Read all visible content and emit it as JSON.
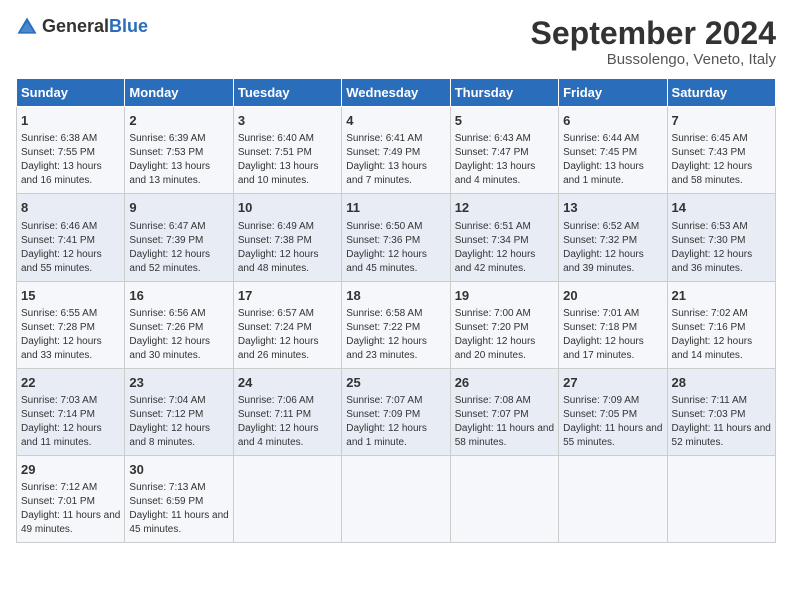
{
  "header": {
    "logo_general": "General",
    "logo_blue": "Blue",
    "month_year": "September 2024",
    "location": "Bussolengo, Veneto, Italy"
  },
  "days_of_week": [
    "Sunday",
    "Monday",
    "Tuesday",
    "Wednesday",
    "Thursday",
    "Friday",
    "Saturday"
  ],
  "weeks": [
    [
      {
        "day": "1",
        "sunrise": "Sunrise: 6:38 AM",
        "sunset": "Sunset: 7:55 PM",
        "daylight": "Daylight: 13 hours and 16 minutes."
      },
      {
        "day": "2",
        "sunrise": "Sunrise: 6:39 AM",
        "sunset": "Sunset: 7:53 PM",
        "daylight": "Daylight: 13 hours and 13 minutes."
      },
      {
        "day": "3",
        "sunrise": "Sunrise: 6:40 AM",
        "sunset": "Sunset: 7:51 PM",
        "daylight": "Daylight: 13 hours and 10 minutes."
      },
      {
        "day": "4",
        "sunrise": "Sunrise: 6:41 AM",
        "sunset": "Sunset: 7:49 PM",
        "daylight": "Daylight: 13 hours and 7 minutes."
      },
      {
        "day": "5",
        "sunrise": "Sunrise: 6:43 AM",
        "sunset": "Sunset: 7:47 PM",
        "daylight": "Daylight: 13 hours and 4 minutes."
      },
      {
        "day": "6",
        "sunrise": "Sunrise: 6:44 AM",
        "sunset": "Sunset: 7:45 PM",
        "daylight": "Daylight: 13 hours and 1 minute."
      },
      {
        "day": "7",
        "sunrise": "Sunrise: 6:45 AM",
        "sunset": "Sunset: 7:43 PM",
        "daylight": "Daylight: 12 hours and 58 minutes."
      }
    ],
    [
      {
        "day": "8",
        "sunrise": "Sunrise: 6:46 AM",
        "sunset": "Sunset: 7:41 PM",
        "daylight": "Daylight: 12 hours and 55 minutes."
      },
      {
        "day": "9",
        "sunrise": "Sunrise: 6:47 AM",
        "sunset": "Sunset: 7:39 PM",
        "daylight": "Daylight: 12 hours and 52 minutes."
      },
      {
        "day": "10",
        "sunrise": "Sunrise: 6:49 AM",
        "sunset": "Sunset: 7:38 PM",
        "daylight": "Daylight: 12 hours and 48 minutes."
      },
      {
        "day": "11",
        "sunrise": "Sunrise: 6:50 AM",
        "sunset": "Sunset: 7:36 PM",
        "daylight": "Daylight: 12 hours and 45 minutes."
      },
      {
        "day": "12",
        "sunrise": "Sunrise: 6:51 AM",
        "sunset": "Sunset: 7:34 PM",
        "daylight": "Daylight: 12 hours and 42 minutes."
      },
      {
        "day": "13",
        "sunrise": "Sunrise: 6:52 AM",
        "sunset": "Sunset: 7:32 PM",
        "daylight": "Daylight: 12 hours and 39 minutes."
      },
      {
        "day": "14",
        "sunrise": "Sunrise: 6:53 AM",
        "sunset": "Sunset: 7:30 PM",
        "daylight": "Daylight: 12 hours and 36 minutes."
      }
    ],
    [
      {
        "day": "15",
        "sunrise": "Sunrise: 6:55 AM",
        "sunset": "Sunset: 7:28 PM",
        "daylight": "Daylight: 12 hours and 33 minutes."
      },
      {
        "day": "16",
        "sunrise": "Sunrise: 6:56 AM",
        "sunset": "Sunset: 7:26 PM",
        "daylight": "Daylight: 12 hours and 30 minutes."
      },
      {
        "day": "17",
        "sunrise": "Sunrise: 6:57 AM",
        "sunset": "Sunset: 7:24 PM",
        "daylight": "Daylight: 12 hours and 26 minutes."
      },
      {
        "day": "18",
        "sunrise": "Sunrise: 6:58 AM",
        "sunset": "Sunset: 7:22 PM",
        "daylight": "Daylight: 12 hours and 23 minutes."
      },
      {
        "day": "19",
        "sunrise": "Sunrise: 7:00 AM",
        "sunset": "Sunset: 7:20 PM",
        "daylight": "Daylight: 12 hours and 20 minutes."
      },
      {
        "day": "20",
        "sunrise": "Sunrise: 7:01 AM",
        "sunset": "Sunset: 7:18 PM",
        "daylight": "Daylight: 12 hours and 17 minutes."
      },
      {
        "day": "21",
        "sunrise": "Sunrise: 7:02 AM",
        "sunset": "Sunset: 7:16 PM",
        "daylight": "Daylight: 12 hours and 14 minutes."
      }
    ],
    [
      {
        "day": "22",
        "sunrise": "Sunrise: 7:03 AM",
        "sunset": "Sunset: 7:14 PM",
        "daylight": "Daylight: 12 hours and 11 minutes."
      },
      {
        "day": "23",
        "sunrise": "Sunrise: 7:04 AM",
        "sunset": "Sunset: 7:12 PM",
        "daylight": "Daylight: 12 hours and 8 minutes."
      },
      {
        "day": "24",
        "sunrise": "Sunrise: 7:06 AM",
        "sunset": "Sunset: 7:11 PM",
        "daylight": "Daylight: 12 hours and 4 minutes."
      },
      {
        "day": "25",
        "sunrise": "Sunrise: 7:07 AM",
        "sunset": "Sunset: 7:09 PM",
        "daylight": "Daylight: 12 hours and 1 minute."
      },
      {
        "day": "26",
        "sunrise": "Sunrise: 7:08 AM",
        "sunset": "Sunset: 7:07 PM",
        "daylight": "Daylight: 11 hours and 58 minutes."
      },
      {
        "day": "27",
        "sunrise": "Sunrise: 7:09 AM",
        "sunset": "Sunset: 7:05 PM",
        "daylight": "Daylight: 11 hours and 55 minutes."
      },
      {
        "day": "28",
        "sunrise": "Sunrise: 7:11 AM",
        "sunset": "Sunset: 7:03 PM",
        "daylight": "Daylight: 11 hours and 52 minutes."
      }
    ],
    [
      {
        "day": "29",
        "sunrise": "Sunrise: 7:12 AM",
        "sunset": "Sunset: 7:01 PM",
        "daylight": "Daylight: 11 hours and 49 minutes."
      },
      {
        "day": "30",
        "sunrise": "Sunrise: 7:13 AM",
        "sunset": "Sunset: 6:59 PM",
        "daylight": "Daylight: 11 hours and 45 minutes."
      },
      null,
      null,
      null,
      null,
      null
    ]
  ]
}
